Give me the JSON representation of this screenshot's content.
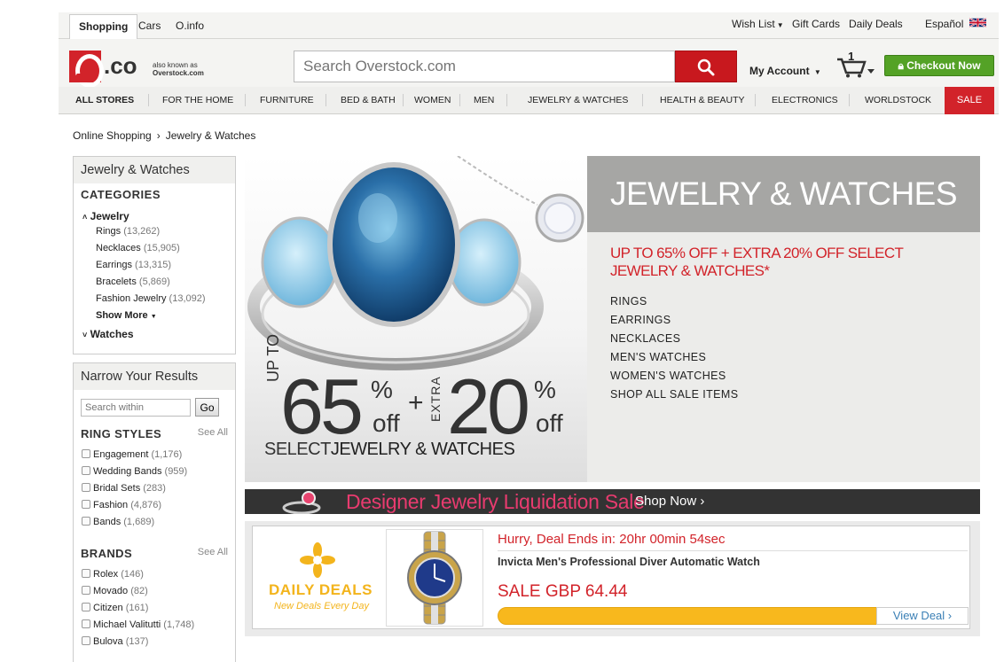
{
  "site_tabs": [
    "Shopping",
    "Cars",
    "O.info"
  ],
  "utility": {
    "wish_list": "Wish List",
    "gift_cards": "Gift Cards",
    "daily_deals": "Daily Deals",
    "language": "Español"
  },
  "logo": {
    "text": ".co",
    "aka_line1": "also known as",
    "aka_line2": "Overstock.com"
  },
  "search": {
    "placeholder": "Search Overstock.com"
  },
  "account": {
    "label": "My Account"
  },
  "cart": {
    "count": "1"
  },
  "checkout": {
    "label": "Checkout Now"
  },
  "nav": {
    "items": [
      "ALL STORES",
      "FOR THE HOME",
      "FURNITURE",
      "BED & BATH",
      "WOMEN",
      "MEN",
      "JEWELRY & WATCHES",
      "HEALTH & BEAUTY",
      "ELECTRONICS",
      "WORLDSTOCK",
      "SALE"
    ]
  },
  "breadcrumb": [
    "Online Shopping",
    "Jewelry & Watches"
  ],
  "sidebar": {
    "title": "Jewelry & Watches",
    "categories_title": "CATEGORIES",
    "jewelry": "Jewelry",
    "jewelry_items": [
      {
        "label": "Rings",
        "count": "(13,262)"
      },
      {
        "label": "Necklaces",
        "count": "(15,905)"
      },
      {
        "label": "Earrings",
        "count": "(13,315)"
      },
      {
        "label": "Bracelets",
        "count": "(5,869)"
      },
      {
        "label": "Fashion Jewelry",
        "count": "(13,092)"
      }
    ],
    "show_more": "Show More",
    "watches": "Watches"
  },
  "narrow": {
    "title": "Narrow Your Results",
    "search_placeholder": "Search within",
    "go": "Go",
    "see_all": "See All",
    "ring_styles_title": "RING STYLES",
    "ring_styles": [
      {
        "label": "Engagement",
        "count": "(1,176)"
      },
      {
        "label": "Wedding Bands",
        "count": "(959)"
      },
      {
        "label": "Bridal Sets",
        "count": "(283)"
      },
      {
        "label": "Fashion",
        "count": "(4,876)"
      },
      {
        "label": "Bands",
        "count": "(1,689)"
      }
    ],
    "brands_title": "BRANDS",
    "brands": [
      {
        "label": "Rolex",
        "count": "(146)"
      },
      {
        "label": "Movado",
        "count": "(82)"
      },
      {
        "label": "Citizen",
        "count": "(161)"
      },
      {
        "label": "Michael Valitutti",
        "count": "(1,748)"
      },
      {
        "label": "Bulova",
        "count": "(137)"
      }
    ]
  },
  "hero": {
    "title": "JEWELRY & WATCHES",
    "promo": "UP TO 65% OFF + EXTRA 20% OFF SELECT JEWELRY & WATCHES*",
    "links": [
      "RINGS",
      "EARRINGS",
      "NECKLACES",
      "MEN'S WATCHES",
      "WOMEN'S WATCHES",
      "SHOP ALL SALE ITEMS"
    ],
    "image_up_to": "UP TO",
    "image_pct1": "65",
    "image_pct2": "20",
    "image_off": "off",
    "image_plus": "+",
    "image_extra": "EXTRA",
    "image_select": "SELECT",
    "image_jw": "JEWELRY & WATCHES"
  },
  "liquidation": {
    "title": "Designer Jewelry Liquidation Sale",
    "shop_now": "Shop Now ›"
  },
  "daily_deal": {
    "logo": "DAILY DEALS",
    "logo_sub": "New Deals Every Day",
    "hurry": "Hurry, Deal Ends in: 20hr 00min 54sec",
    "product": "Invicta Men's Professional Diver Automatic Watch",
    "price": "SALE GBP 64.44",
    "view": "View Deal ›"
  },
  "colors": {
    "brand_red": "#d2232a",
    "checkout_green": "#54a226",
    "deal_orange": "#f8b81d",
    "liquidation_pink": "#e83b6f"
  }
}
